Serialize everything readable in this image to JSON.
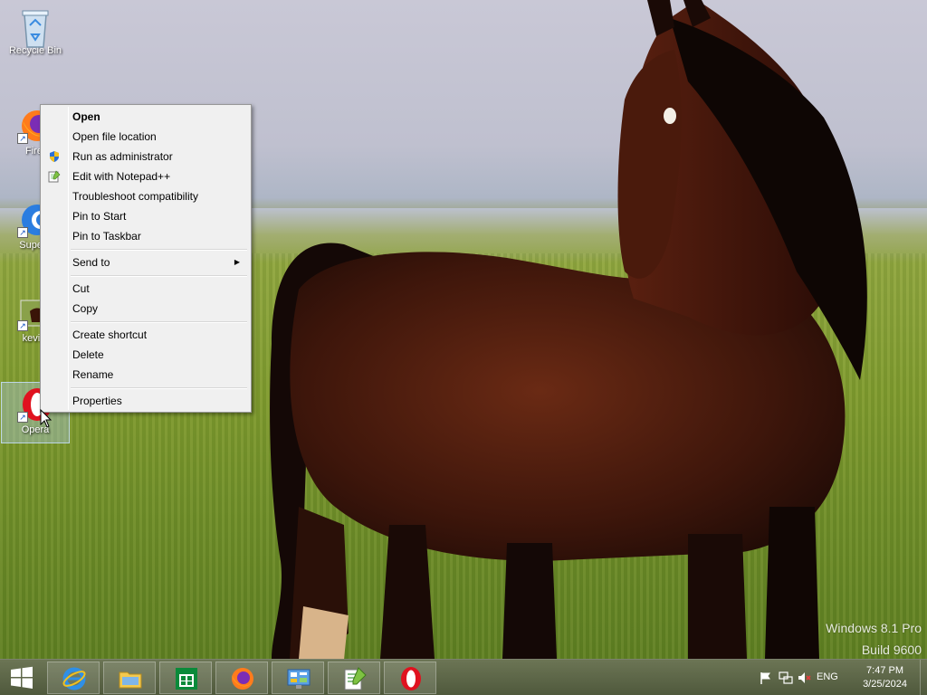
{
  "watermark": {
    "line1": "Windows 8.1 Pro",
    "line2": "Build 9600"
  },
  "desktop_icons": [
    {
      "label": "Recycle Bin",
      "icon": "recycle-bin-icon"
    },
    {
      "label": "Firef",
      "icon": "firefox-icon"
    },
    {
      "label": "Supern",
      "icon": "supernova-icon"
    },
    {
      "label": "kevin.",
      "icon": "image-file-icon"
    },
    {
      "label": "Opera",
      "icon": "opera-icon"
    }
  ],
  "context_menu": {
    "items": [
      {
        "label": "Open",
        "bold": true
      },
      {
        "label": "Open file location"
      },
      {
        "label": "Run as administrator",
        "icon": "uac-shield-icon"
      },
      {
        "label": "Edit with Notepad++",
        "icon": "notepadpp-icon"
      },
      {
        "label": "Troubleshoot compatibility"
      },
      {
        "label": "Pin to Start"
      },
      {
        "label": "Pin to Taskbar"
      },
      {
        "label": "Send to",
        "submenu": true
      },
      {
        "label": "Cut"
      },
      {
        "label": "Copy"
      },
      {
        "label": "Create shortcut"
      },
      {
        "label": "Delete"
      },
      {
        "label": "Rename"
      },
      {
        "label": "Properties"
      }
    ]
  },
  "taskbar": {
    "pinned": [
      {
        "name": "Internet Explorer",
        "icon": "internet-explorer-icon"
      },
      {
        "name": "File Explorer",
        "icon": "file-explorer-icon"
      },
      {
        "name": "Store",
        "icon": "store-icon"
      },
      {
        "name": "Firefox",
        "icon": "firefox-icon"
      },
      {
        "name": "Control Panel",
        "icon": "control-panel-icon"
      },
      {
        "name": "Notepad++",
        "icon": "notepadpp-icon"
      },
      {
        "name": "Opera",
        "icon": "opera-icon"
      }
    ],
    "tray": {
      "language": "ENG",
      "time": "7:47 PM",
      "date": "3/25/2024"
    }
  },
  "colors": {
    "menu_bg": "#f0f0f0",
    "taskbar": "#5f6946",
    "opera_red": "#e0121f"
  }
}
